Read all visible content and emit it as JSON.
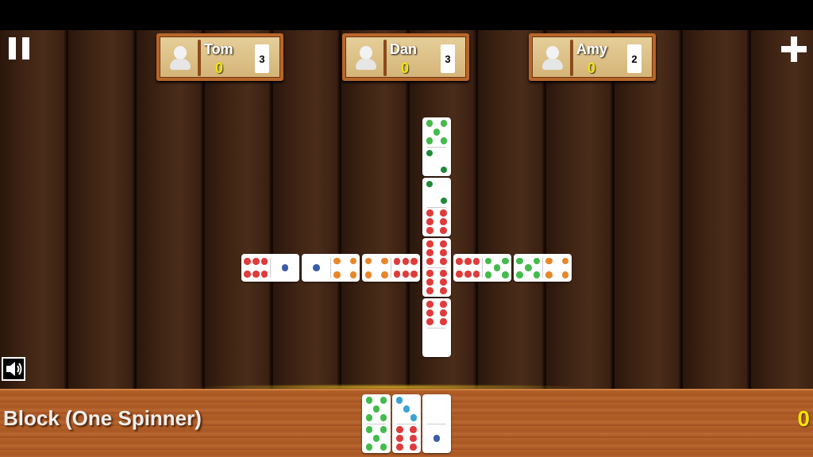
{
  "header": {
    "pause_icon": "pause-icon",
    "add_icon": "plus-icon"
  },
  "players": [
    {
      "name": "Tom",
      "score": "0",
      "tiles_left": "3"
    },
    {
      "name": "Dan",
      "score": "0",
      "tiles_left": "3"
    },
    {
      "name": "Amy",
      "score": "0",
      "tiles_left": "2"
    }
  ],
  "pip_colors": {
    "1": "#3b5ca8",
    "2": "#1f8a38",
    "3": "#3aa3d4",
    "4": "#e8862c",
    "5": "#44bb4c",
    "6": "#e03b3b"
  },
  "board": {
    "spinner": [
      6,
      6
    ],
    "vertical_up": [
      [
        5,
        2
      ],
      [
        2,
        6
      ]
    ],
    "vertical_down": [
      [
        6,
        0
      ]
    ],
    "horizontal_left": [
      [
        6,
        1
      ],
      [
        1,
        4
      ],
      [
        4,
        6
      ]
    ],
    "horizontal_right": [
      [
        6,
        5
      ],
      [
        5,
        4
      ]
    ]
  },
  "hand": [
    [
      5,
      5
    ],
    [
      3,
      6
    ],
    [
      0,
      1
    ]
  ],
  "footer": {
    "game_mode": "Block (One Spinner)",
    "my_score": "0",
    "sound_icon": "speaker-icon"
  }
}
